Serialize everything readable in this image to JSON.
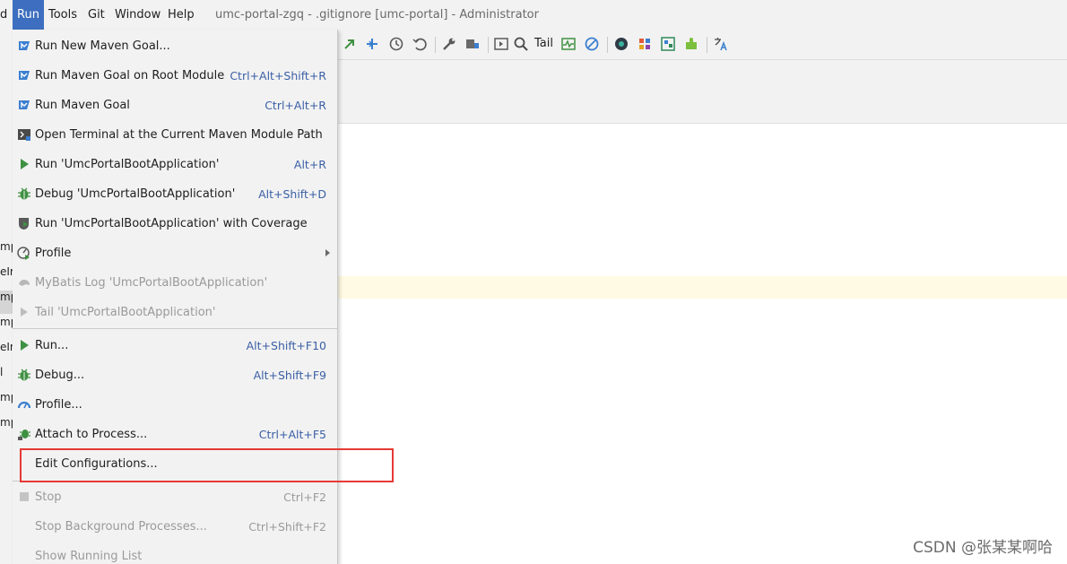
{
  "menubar": {
    "items": [
      "d",
      "Run",
      "Tools",
      "Git",
      "Window",
      "Help"
    ],
    "window_title": "umc-portal-zgq - .gitignore [umc-portal] - Administrator"
  },
  "toolbar": {
    "tail_label": "Tail"
  },
  "left_tree": {
    "fragments": [
      "mp",
      "eIr",
      "mp",
      "mp",
      "eIm",
      "l",
      "mp",
      "mp"
    ]
  },
  "run_menu": {
    "items": [
      {
        "label": "Run New Maven Goal...",
        "shortcut": "",
        "icon": "maven-icon"
      },
      {
        "label": "Run Maven Goal on Root Module",
        "shortcut": "Ctrl+Alt+Shift+R",
        "icon": "maven-icon"
      },
      {
        "label": "Run Maven Goal",
        "shortcut": "Ctrl+Alt+R",
        "icon": "maven-icon"
      },
      {
        "label": "Open Terminal at the Current Maven Module Path",
        "shortcut": "",
        "icon": "terminal-icon"
      },
      {
        "label": "Run 'UmcPortalBootApplication'",
        "shortcut": "Alt+R",
        "icon": "run-icon"
      },
      {
        "label": "Debug 'UmcPortalBootApplication'",
        "shortcut": "Alt+Shift+D",
        "icon": "debug-icon"
      },
      {
        "label": "Run 'UmcPortalBootApplication' with Coverage",
        "shortcut": "",
        "icon": "coverage-icon"
      },
      {
        "label": "Profile",
        "shortcut": "",
        "icon": "profile-icon"
      },
      {
        "label": "MyBatis Log 'UmcPortalBootApplication'",
        "shortcut": "",
        "icon": "mybatis-icon"
      },
      {
        "label": "Tail 'UmcPortalBootApplication'",
        "shortcut": "",
        "icon": "tail-icon"
      },
      {
        "label": "Run...",
        "shortcut": "Alt+Shift+F10",
        "icon": "run-icon"
      },
      {
        "label": "Debug...",
        "shortcut": "Alt+Shift+F9",
        "icon": "debug-icon"
      },
      {
        "label": "Profile...",
        "shortcut": "",
        "icon": "profiler-gauge-icon"
      },
      {
        "label": "Attach to Process...",
        "shortcut": "Ctrl+Alt+F5",
        "icon": "attach-debug-icon"
      },
      {
        "label": "Edit Configurations...",
        "shortcut": "",
        "icon": ""
      },
      {
        "label": "Stop",
        "shortcut": "Ctrl+F2",
        "icon": "stop-icon"
      },
      {
        "label": "Stop Background Processes...",
        "shortcut": "Ctrl+Shift+F2",
        "icon": ""
      },
      {
        "label": "Show Running List",
        "shortcut": "",
        "icon": ""
      }
    ]
  },
  "watermark": "CSDN @张某某啊哈",
  "colors": {
    "menu_active": "#3d6ebf",
    "shortcut": "#3a5fa5",
    "run_green": "#3f9142",
    "highlight_red": "#e53935",
    "maven_blue": "#3b7fd0"
  }
}
